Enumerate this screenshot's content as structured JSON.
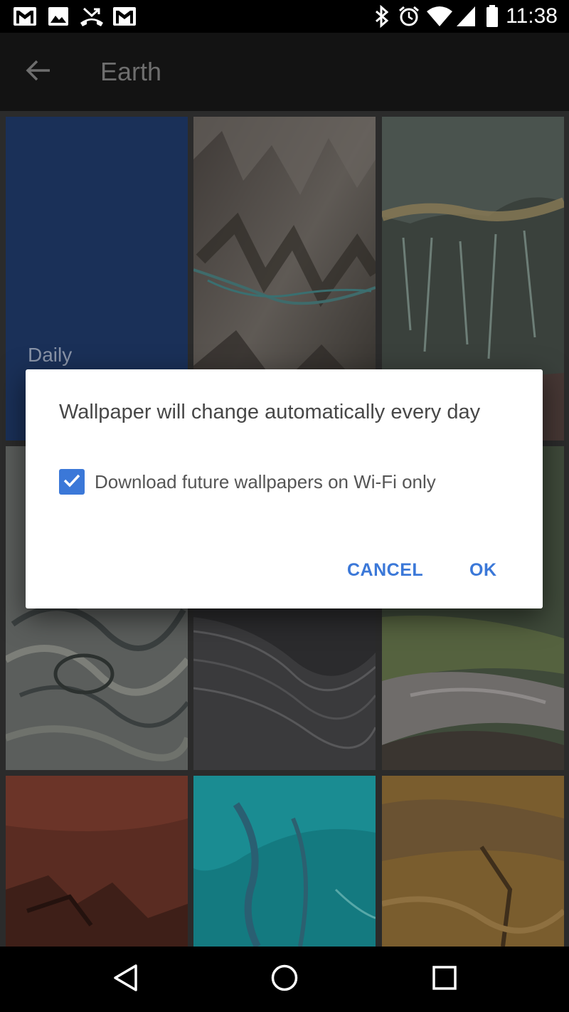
{
  "status_bar": {
    "time": "11:38",
    "left_icons": [
      "gmail-icon",
      "image-icon",
      "missed-call-icon",
      "gmail-icon"
    ],
    "right_icons": [
      "bluetooth-icon",
      "alarm-icon",
      "wifi-icon",
      "signal-icon",
      "battery-icon"
    ]
  },
  "toolbar": {
    "title": "Earth",
    "back_icon": "arrow-back-icon"
  },
  "grid": {
    "daily_tile_label": "Daily"
  },
  "dialog": {
    "message": "Wallpaper will change automatically every day",
    "checkbox_label": "Download future wallpapers on Wi-Fi only",
    "checkbox_checked": true,
    "cancel_label": "CANCEL",
    "ok_label": "OK",
    "accent_color": "#3b78d8"
  },
  "nav_bar": {
    "buttons": [
      "back-triangle-icon",
      "home-circle-icon",
      "recents-square-icon"
    ]
  }
}
